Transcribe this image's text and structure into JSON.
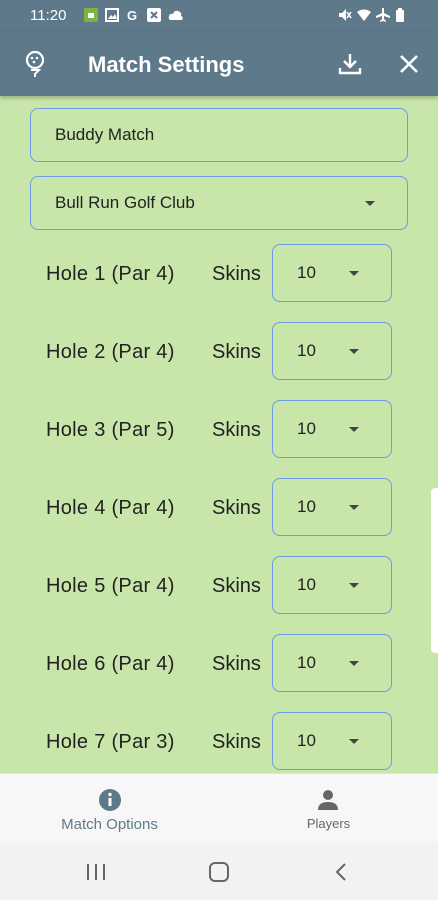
{
  "status_bar": {
    "time": "11:20",
    "left_icons": [
      "android-notification-icon",
      "image-icon",
      "google-icon",
      "close-box-icon",
      "cloud-icon"
    ],
    "right_icons": [
      "mute-icon",
      "wifi-icon",
      "airplane-icon",
      "battery-icon"
    ]
  },
  "app_bar": {
    "title": "Match Settings",
    "leading_icon": "golf-tee-icon",
    "actions": [
      "download-icon",
      "close-icon"
    ],
    "background_color": "#5e7a8a"
  },
  "form": {
    "match_name": "Buddy Match",
    "course": "Bull Run Golf Club",
    "skins_label": "Skins",
    "holes": [
      {
        "label": "Hole 1  (Par 4)",
        "skins": "10"
      },
      {
        "label": "Hole 2  (Par 4)",
        "skins": "10"
      },
      {
        "label": "Hole 3  (Par 5)",
        "skins": "10"
      },
      {
        "label": "Hole 4  (Par 4)",
        "skins": "10"
      },
      {
        "label": "Hole 5  (Par 4)",
        "skins": "10"
      },
      {
        "label": "Hole 6  (Par 4)",
        "skins": "10"
      },
      {
        "label": "Hole 7  (Par 3)",
        "skins": "10"
      }
    ],
    "field_border_color": "#6e9bea",
    "background_color": "#c8e6a9"
  },
  "bottom_nav": {
    "tabs": [
      {
        "label": "Match Options",
        "icon": "info-icon",
        "active": true
      },
      {
        "label": "Players",
        "icon": "person-icon",
        "active": false
      }
    ]
  },
  "system_nav": [
    "recents-icon",
    "home-icon",
    "back-icon"
  ]
}
